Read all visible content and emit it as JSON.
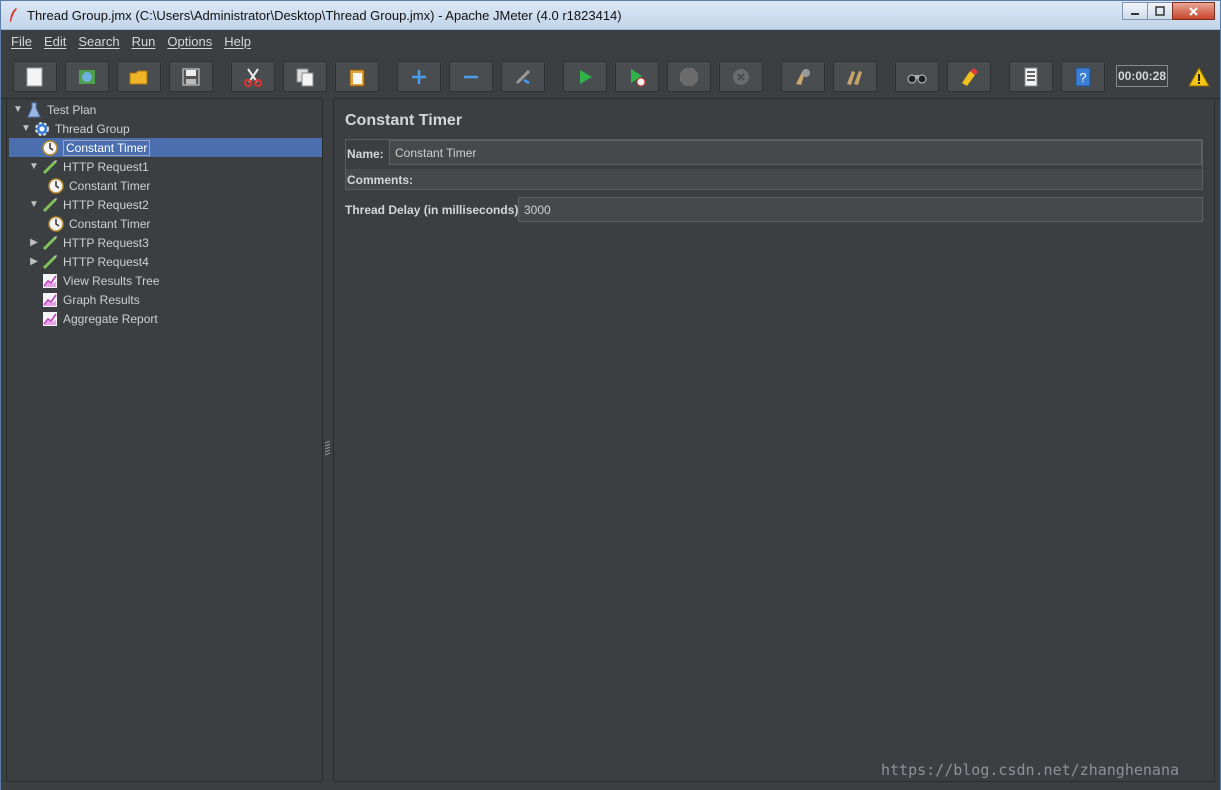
{
  "window": {
    "title": "Thread Group.jmx (C:\\Users\\Administrator\\Desktop\\Thread Group.jmx) - Apache JMeter (4.0 r1823414)"
  },
  "menu": [
    "File",
    "Edit",
    "Search",
    "Run",
    "Options",
    "Help"
  ],
  "toolbar": {
    "timer": "00:00:28",
    "buttons": [
      {
        "name": "new-icon"
      },
      {
        "name": "templates-icon"
      },
      {
        "name": "open-icon"
      },
      {
        "name": "save-icon"
      },
      {
        "name": "cut-icon"
      },
      {
        "name": "copy-icon"
      },
      {
        "name": "paste-icon"
      },
      {
        "name": "expand-icon"
      },
      {
        "name": "collapse-icon"
      },
      {
        "name": "toggle-icon"
      },
      {
        "name": "start-icon"
      },
      {
        "name": "start-no-timers-icon"
      },
      {
        "name": "stop-icon"
      },
      {
        "name": "shutdown-icon"
      },
      {
        "name": "clear-icon"
      },
      {
        "name": "clear-all-icon"
      },
      {
        "name": "search-icon"
      },
      {
        "name": "reset-search-icon"
      },
      {
        "name": "function-helper-icon"
      },
      {
        "name": "help-icon"
      }
    ]
  },
  "tree": [
    {
      "label": "Test Plan",
      "icon": "test-plan-icon"
    },
    {
      "label": "Thread Group",
      "icon": "thread-group-icon"
    },
    {
      "label": "Constant Timer",
      "icon": "timer-icon"
    },
    {
      "label": "HTTP Request1",
      "icon": "sampler-icon"
    },
    {
      "label": "Constant Timer",
      "icon": "timer-icon"
    },
    {
      "label": "HTTP Request2",
      "icon": "sampler-icon"
    },
    {
      "label": "Constant Timer",
      "icon": "timer-icon"
    },
    {
      "label": "HTTP Request3",
      "icon": "sampler-icon"
    },
    {
      "label": "HTTP Request4",
      "icon": "sampler-icon"
    },
    {
      "label": "View Results Tree",
      "icon": "listener-icon"
    },
    {
      "label": "Graph Results",
      "icon": "listener-icon"
    },
    {
      "label": "Aggregate Report",
      "icon": "listener-icon"
    }
  ],
  "panel": {
    "title": "Constant Timer",
    "name_label": "Name:",
    "name_value": "Constant Timer",
    "comments_label": "Comments:",
    "delay_label": "Thread Delay (in milliseconds):",
    "delay_value": "3000"
  },
  "watermark": "https://blog.csdn.net/zhanghenana"
}
